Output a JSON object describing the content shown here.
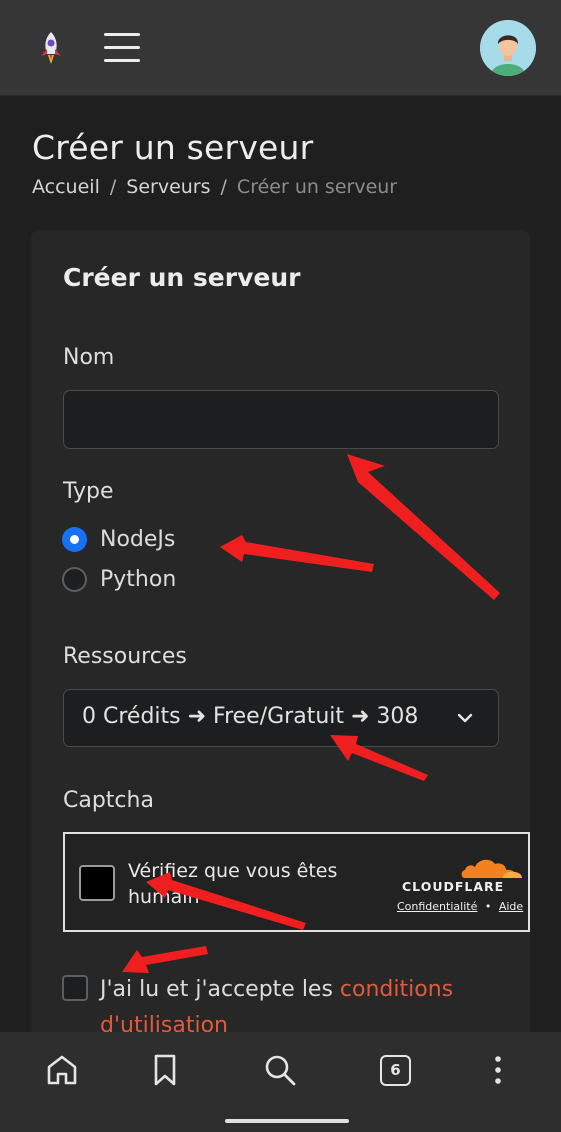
{
  "header": {
    "logo_icon": "rocket-icon",
    "menu_icon": "hamburger-menu-icon",
    "avatar_icon": "user-avatar-icon"
  },
  "page": {
    "title": "Créer un serveur",
    "breadcrumb": [
      "Accueil",
      "Serveurs",
      "Créer un serveur"
    ]
  },
  "form": {
    "card_title": "Créer un serveur",
    "name_label": "Nom",
    "name_value": "",
    "type_label": "Type",
    "type_options": [
      "NodeJs",
      "Python"
    ],
    "type_selected": "NodeJs",
    "resources_label": "Ressources",
    "resources_selected": "0 Crédits ➜ Free/Gratuit ➜ 308",
    "captcha_label": "Captcha",
    "captcha": {
      "text": "Vérifiez que vous êtes humain",
      "brand": "CLOUDFLARE",
      "privacy_link": "Confidentialité",
      "separator": "•",
      "help_link": "Aide"
    },
    "terms": {
      "prefix": "J'ai lu et j'accepte les ",
      "link": "conditions d'utilisation"
    }
  },
  "bottom_nav": {
    "home_icon": "home-icon",
    "bookmark_icon": "bookmark-icon",
    "search_icon": "search-icon",
    "tabs_count": "6",
    "more_icon": "more-vertical-icon"
  },
  "colors": {
    "background": "#1f1f20",
    "card": "#272728",
    "accent_blue": "#1671f5",
    "link_orange": "#e25a3b",
    "annotation_red": "#f01f1f",
    "cloudflare_orange": "#f48120"
  }
}
